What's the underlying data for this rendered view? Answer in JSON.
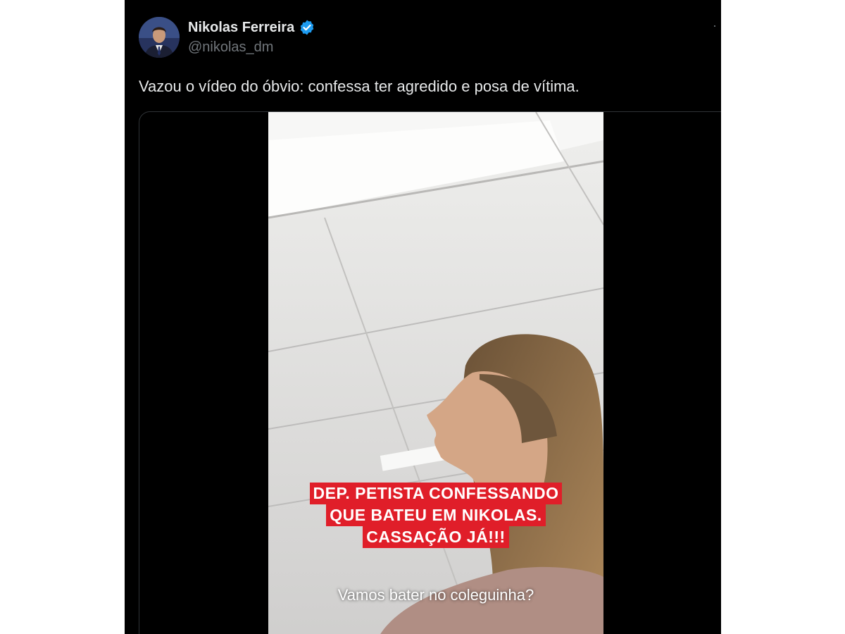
{
  "post": {
    "author_name": "Nikolas Ferreira",
    "handle": "@nikolas_dm",
    "verified_icon": "verified-badge-icon",
    "more_icon": "more-options-icon",
    "text": "Vazou o vídeo do óbvio: confessa ter agredido e posa de vítima."
  },
  "video": {
    "caption_lines": [
      "DEP. PETISTA CONFESSANDO",
      "QUE BATEU EM NIKOLAS.",
      "CASSAÇÃO JÁ!!!"
    ],
    "subtitle": "Vamos bater no coleguinha?"
  },
  "colors": {
    "background": "#000000",
    "text_primary": "#e7e9ea",
    "text_secondary": "#71767b",
    "verified_blue": "#1d9bf0",
    "caption_red": "#e01e29"
  }
}
